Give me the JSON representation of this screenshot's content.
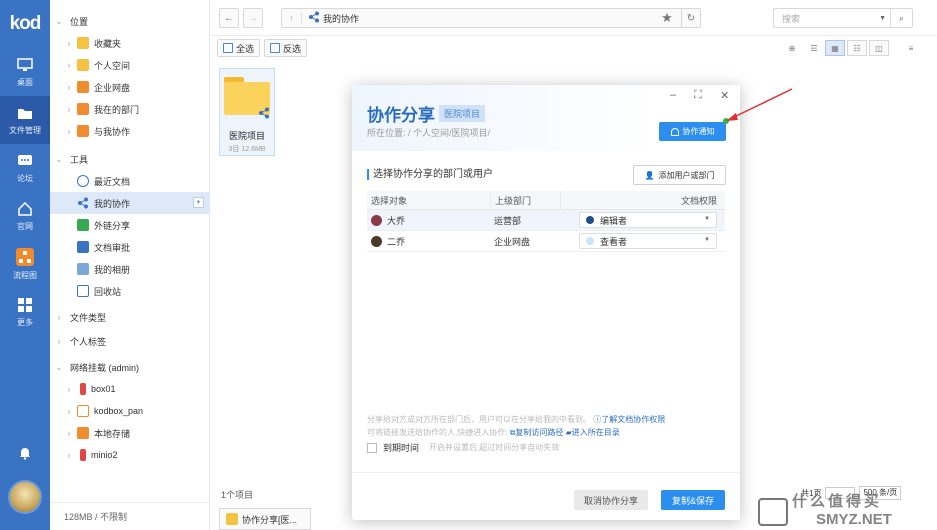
{
  "app": {
    "logo": "kod"
  },
  "left_nav": {
    "items": [
      {
        "label": "桌面",
        "icon": "monitor-icon"
      },
      {
        "label": "文件管理",
        "icon": "folder-icon",
        "active": true
      },
      {
        "label": "论坛",
        "icon": "chat-icon"
      },
      {
        "label": "官网",
        "icon": "home-icon"
      },
      {
        "label": "流程图",
        "icon": "flowchart-icon"
      },
      {
        "label": "更多",
        "icon": "grid-icon"
      }
    ]
  },
  "tree": {
    "sections": [
      {
        "label": "位置"
      },
      {
        "label": "工具"
      },
      {
        "label": "文件类型"
      },
      {
        "label": "个人标签"
      },
      {
        "label": "网络挂载 (admin)"
      }
    ],
    "location_items": [
      "收藏夹",
      "个人空间",
      "企业网盘",
      "我在的部门",
      "与我协作"
    ],
    "tool_items": [
      "最近文档",
      "我的协作",
      "外链分享",
      "文档审批",
      "我的相册",
      "回收站"
    ],
    "mount_items": [
      "box01",
      "kodbox_pan",
      "本地存储",
      "minio2"
    ],
    "footer": "128MB / 不限制"
  },
  "toolbar": {
    "breadcrumb": "我的协作",
    "search_placeholder": "搜索",
    "select_all": "全选",
    "invert": "反选"
  },
  "files": [
    {
      "name": "医院项目",
      "meta": "3目 12.6MB"
    }
  ],
  "main_footer": {
    "count": "1个项目",
    "download_tab": "协作分享[医...",
    "pager_total": "共1页",
    "pager_size": "500 条/页"
  },
  "dialog": {
    "title": "协作分享",
    "tag": "医院项目",
    "path": "所在位置: / 个人空间/医院项目/",
    "notify_label": "协作通知",
    "section_title": "选择协作分享的部门或用户",
    "add_button": "添加用户或部门",
    "columns": [
      "选择对象",
      "上级部门",
      "文档权限"
    ],
    "rows": [
      {
        "name": "大乔",
        "dept": "运营部",
        "perm": "编辑者",
        "perm_color": "#1f4e8c",
        "avatar_color": "#8b3a4a"
      },
      {
        "name": "二乔",
        "dept": "企业网盘",
        "perm": "查看者",
        "perm_color": "#cfe2f7",
        "avatar_color": "#4a3a2a"
      }
    ],
    "tip_line1": "分享给对方或对方所在部门后，用户可以在分享给我的中看到。",
    "tip_link1": "了解文档协作权限",
    "tip_line2": "可将链接发送给协作的人,快捷进入协作:",
    "tip_link2": "复制访问路径",
    "tip_link3": "进入所在目录",
    "expire_label": "到期时间",
    "expire_hint": "开启并设置后,超过时间分享自动失效",
    "cancel_button": "取消协作分享",
    "save_button": "复制&保存"
  },
  "watermark": {
    "top": "什么值得买",
    "bottom": "SMYZ.NET"
  }
}
